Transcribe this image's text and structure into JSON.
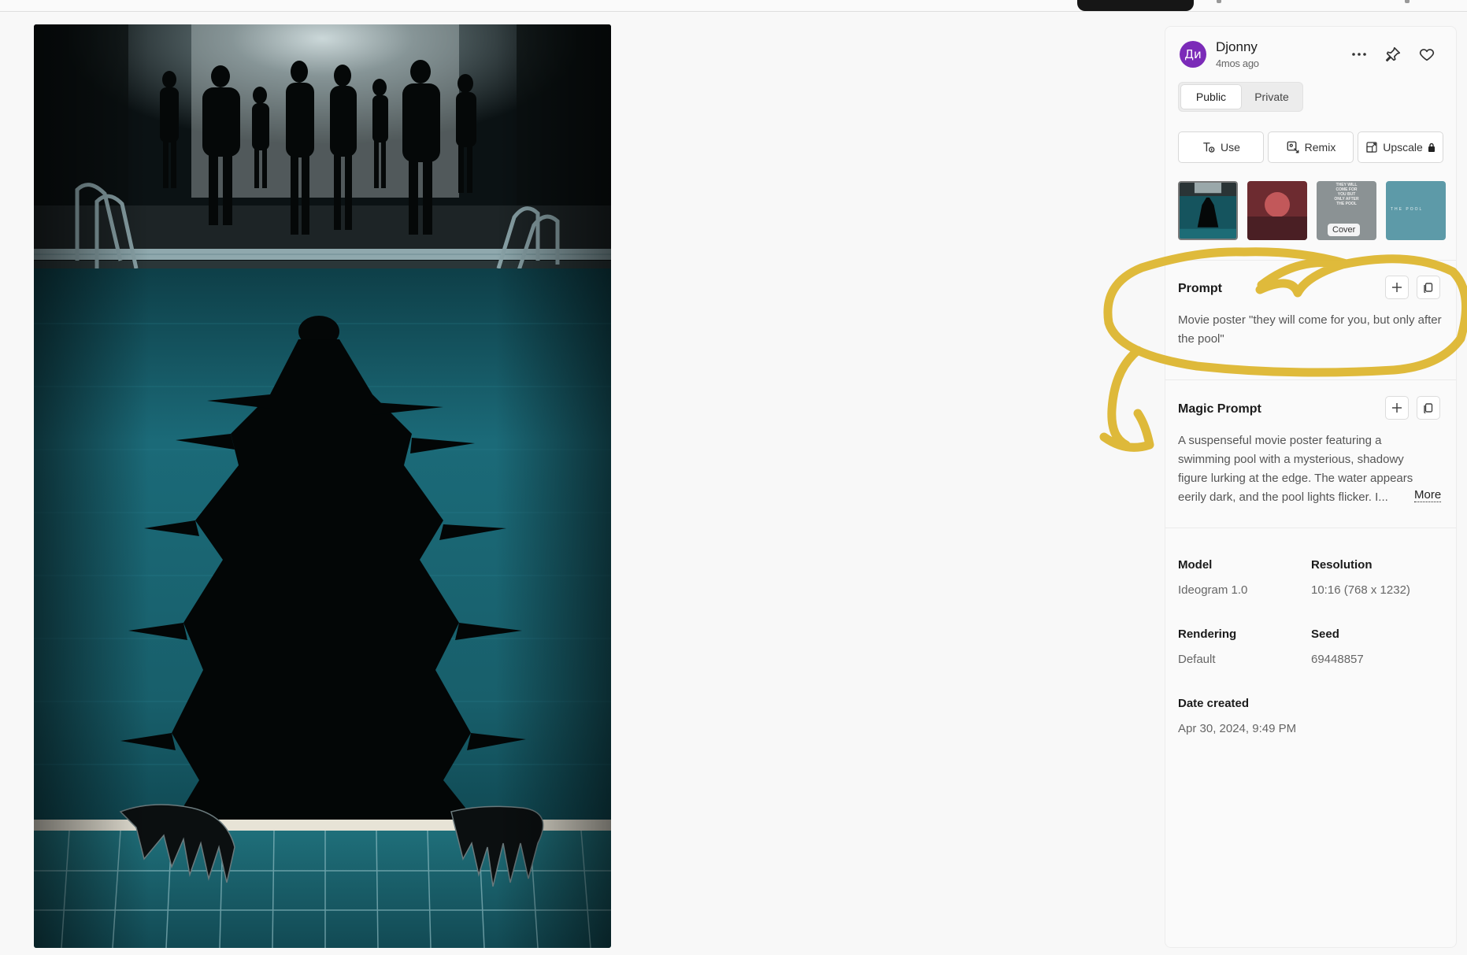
{
  "author": {
    "avatar_text": "Ди",
    "name": "Djonny",
    "time_ago": "4mos ago"
  },
  "visibility": {
    "options": [
      "Public",
      "Private"
    ],
    "selected": "Public"
  },
  "actions": {
    "use_label": "Use",
    "remix_label": "Remix",
    "upscale_label": "Upscale"
  },
  "thumbnails": {
    "cover_label": "Cover",
    "thumb3_text": "THEY WILL COME FOR YOU BUT ONLY AFTER THE POOL",
    "thumb4_text": "THE POOL"
  },
  "prompt": {
    "title": "Prompt",
    "text": "Movie poster \"they will come for you, but only after the pool\""
  },
  "magic_prompt": {
    "title": "Magic Prompt",
    "text": "A suspenseful movie poster featuring a swimming pool with a mysterious, shadowy figure lurking at the edge. The water appears eerily dark, and the pool lights flicker. I...",
    "more_label": "More"
  },
  "details": {
    "model_label": "Model",
    "model_value": "Ideogram 1.0",
    "resolution_label": "Resolution",
    "resolution_value": "10:16 (768 x 1232)",
    "rendering_label": "Rendering",
    "rendering_value": "Default",
    "seed_label": "Seed",
    "seed_value": "69448857",
    "date_label": "Date created",
    "date_value": "Apr 30, 2024, 9:49 PM"
  },
  "colors": {
    "avatar_bg": "#7b2bb8",
    "annotation_yellow": "#dcb42a",
    "water_teal": "#17606c"
  }
}
